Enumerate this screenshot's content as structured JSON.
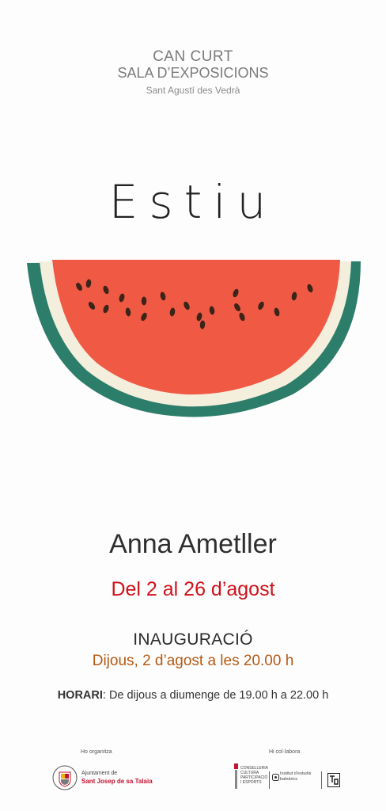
{
  "venue": {
    "name": "CAN CURT",
    "subtitle": "SALA D’EXPOSICIONS",
    "location": "Sant Agustí des Vedrà"
  },
  "exhibition_title": "Estiu",
  "artist": "Anna Ametller",
  "dates": "Del 2 al 26 d’agost",
  "inauguration": {
    "label": "INAUGURACIÓ",
    "datetime": "Dijous, 2 d’agost a les 20.00 h"
  },
  "hours": {
    "label": "HORARI",
    "text": ": De dijous a diumenge de 19.00 h a 22.00 h"
  },
  "footer": {
    "organized_label": "Ho organitza",
    "organizer_line1": "Ajuntament de",
    "organizer_line2": "Sant Josep de sa Talaia",
    "collab_label": "Hi col·labora",
    "conselleria": [
      "CONSELLERIA",
      "CULTURA",
      "PARTICIPACIÓ",
      "I ESPORTS"
    ],
    "institut": [
      "Institut d’estudis",
      "baleàrics"
    ]
  },
  "colors": {
    "rind": "#2d7d6b",
    "white_rind": "#f4efdd",
    "flesh": "#f05a45",
    "seeds": "#3b2418",
    "date_red": "#d0121b",
    "inaug_brown": "#b45a14"
  }
}
